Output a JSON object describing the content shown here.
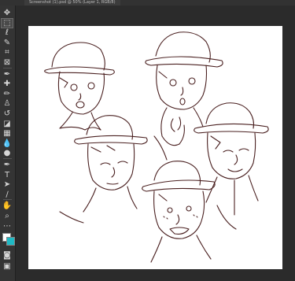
{
  "document_tab": {
    "label": "Screenshot (1).psd @ 50% (Layer 1, RGB/8)"
  },
  "toolbar": {
    "tools": [
      {
        "name": "move-tool",
        "glyph": "✥"
      },
      {
        "name": "marquee-tool",
        "glyph": "⬚"
      },
      {
        "name": "lasso-tool",
        "glyph": "ℓ"
      },
      {
        "name": "quick-select-tool",
        "glyph": "✎"
      },
      {
        "name": "crop-tool",
        "glyph": "⌗"
      },
      {
        "name": "frame-tool",
        "glyph": "⊠"
      },
      {
        "name": "eyedropper-tool",
        "glyph": "✒"
      },
      {
        "name": "healing-brush-tool",
        "glyph": "✚"
      },
      {
        "name": "brush-tool",
        "glyph": "✏"
      },
      {
        "name": "clone-stamp-tool",
        "glyph": "♙"
      },
      {
        "name": "history-brush-tool",
        "glyph": "↺"
      },
      {
        "name": "eraser-tool",
        "glyph": "◪"
      },
      {
        "name": "gradient-tool",
        "glyph": "▦"
      },
      {
        "name": "blur-tool",
        "glyph": "💧"
      },
      {
        "name": "dodge-tool",
        "glyph": "●"
      },
      {
        "name": "pen-tool",
        "glyph": "✒"
      },
      {
        "name": "type-tool",
        "glyph": "T"
      },
      {
        "name": "path-select-tool",
        "glyph": "➤"
      },
      {
        "name": "line-tool",
        "glyph": "∕"
      },
      {
        "name": "hand-tool",
        "glyph": "✋"
      },
      {
        "name": "zoom-tool",
        "glyph": "⌕"
      },
      {
        "name": "more-tools",
        "glyph": "⋯"
      }
    ],
    "bottom": [
      {
        "name": "quick-mask",
        "glyph": "◙"
      },
      {
        "name": "screen-mode",
        "glyph": "▣"
      }
    ],
    "colors": {
      "foreground": "#ffffff",
      "background": "#1fb9c4"
    }
  },
  "canvas": {
    "background": "#ffffff",
    "line_color": "#4a2020",
    "content": "sketch-of-five-faces-with-hats"
  }
}
